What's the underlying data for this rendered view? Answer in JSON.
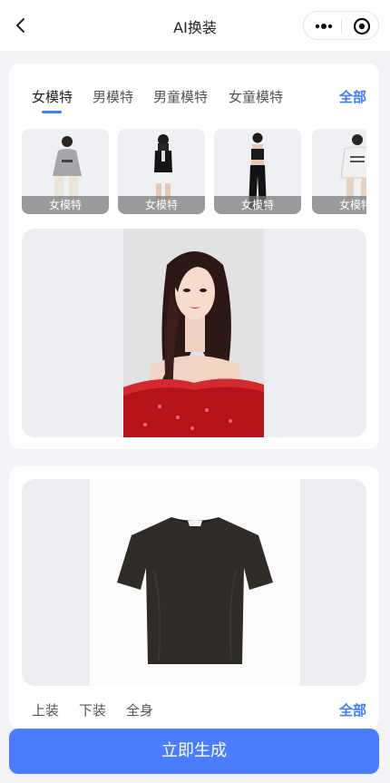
{
  "nav": {
    "title": "AI换装",
    "back_icon": "chevron-left-icon",
    "more_icon": "more-dots-icon",
    "close_icon": "target-circle-icon"
  },
  "models": {
    "tabs": [
      {
        "label": "女模特",
        "active": true
      },
      {
        "label": "男模特",
        "active": false
      },
      {
        "label": "男童模特",
        "active": false
      },
      {
        "label": "女童模特",
        "active": false
      }
    ],
    "all_label": "全部",
    "thumbnails": [
      {
        "label": "女模特"
      },
      {
        "label": "女模特"
      },
      {
        "label": "女模特"
      },
      {
        "label": "女模特"
      }
    ]
  },
  "clothes": {
    "tabs": [
      {
        "label": "上装"
      },
      {
        "label": "下装"
      },
      {
        "label": "全身"
      }
    ],
    "all_label": "全部"
  },
  "generate_label": "立即生成",
  "colors": {
    "accent": "#3d7bff",
    "button": "#4a7dfb"
  }
}
